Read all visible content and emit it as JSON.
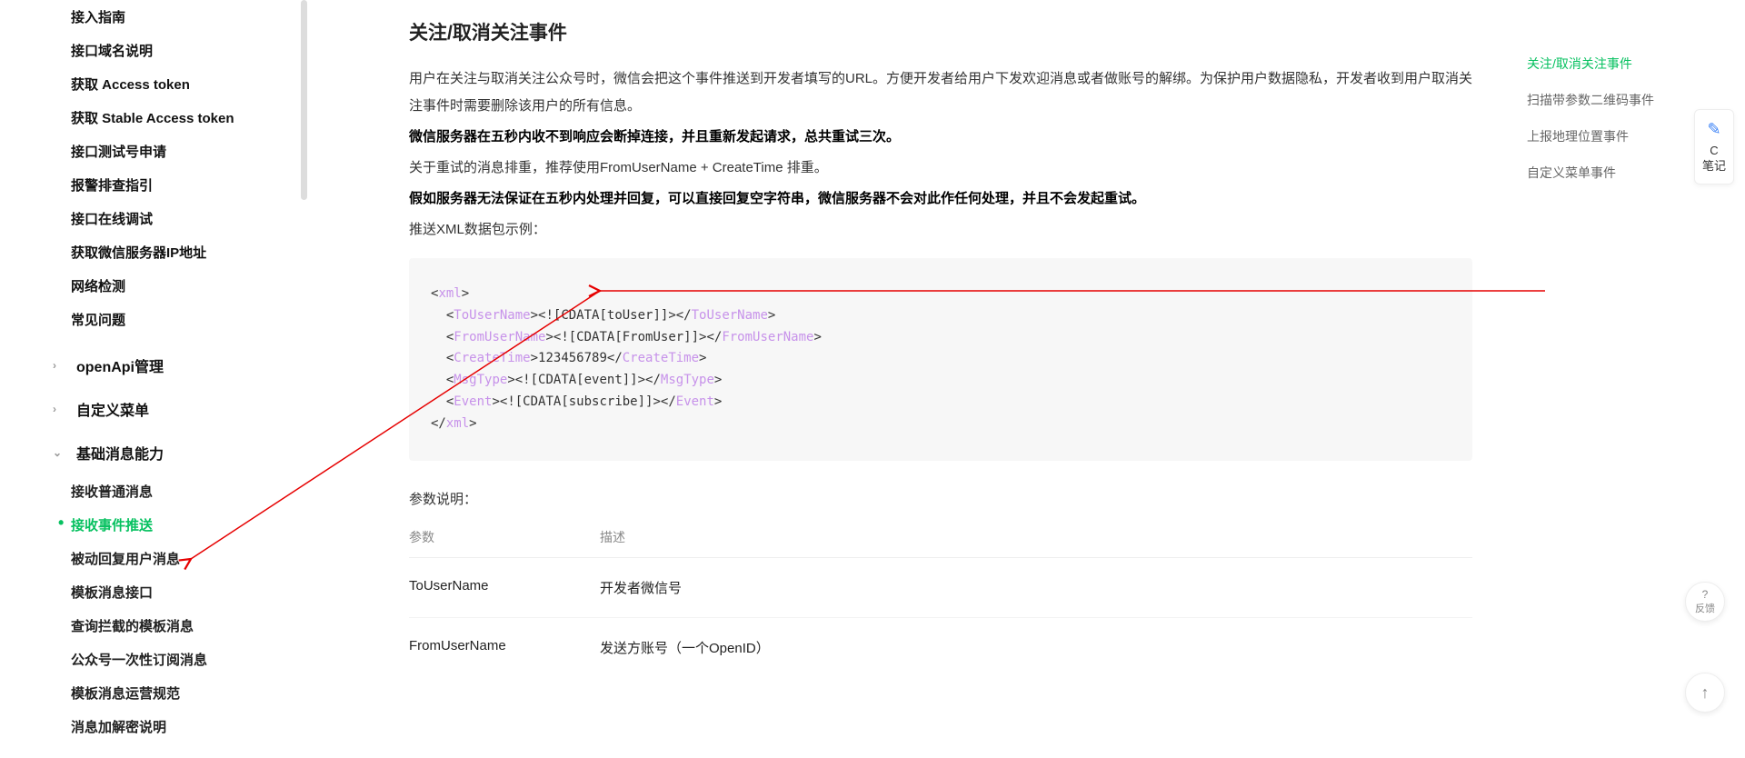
{
  "sidebar": {
    "top_items": [
      "接入指南",
      "接口域名说明",
      "获取 Access token",
      "获取 Stable Access token",
      "接口测试号申请",
      "报警排查指引",
      "接口在线调试",
      "获取微信服务器IP地址",
      "网络检测",
      "常见问题"
    ],
    "groups": [
      {
        "label": "openApi管理",
        "expanded": false,
        "items": []
      },
      {
        "label": "自定义菜单",
        "expanded": false,
        "items": []
      },
      {
        "label": "基础消息能力",
        "expanded": true,
        "items": [
          "接收普通消息",
          "接收事件推送",
          "被动回复用户消息",
          "模板消息接口",
          "查询拦截的模板消息",
          "公众号一次性订阅消息",
          "模板消息运营规范",
          "消息加解密说明"
        ]
      }
    ],
    "active_item": "接收事件推送"
  },
  "content": {
    "heading": "关注/取消关注事件",
    "para1": "用户在关注与取消关注公众号时，微信会把这个事件推送到开发者填写的URL。方便开发者给用户下发欢迎消息或者做账号的解绑。为保护用户数据隐私，开发者收到用户取消关注事件时需要删除该用户的所有信息。",
    "para2": "微信服务器在五秒内收不到响应会断掉连接，并且重新发起请求，总共重试三次。",
    "para3": "关于重试的消息排重，推荐使用FromUserName + CreateTime 排重。",
    "para4": "假如服务器无法保证在五秒内处理并回复，可以直接回复空字符串，微信服务器不会对此作任何处理，并且不会发起重试。",
    "para5": "推送XML数据包示例：",
    "code": {
      "l1a": "xml",
      "l2a": "ToUserName",
      "l2b": "<![CDATA[toUser]]>",
      "l2c": "ToUserName",
      "l3a": "FromUserName",
      "l3b": "<![CDATA[FromUser]]>",
      "l3c": "FromUserName",
      "l4a": "CreateTime",
      "l4b": "123456789",
      "l4c": "CreateTime",
      "l5a": "MsgType",
      "l5b": "<![CDATA[event]]>",
      "l5c": "MsgType",
      "l6a": "Event",
      "l6b": "<![CDATA[subscribe]]>",
      "l6c": "Event",
      "l7a": "xml"
    },
    "param_label": "参数说明：",
    "param_head": {
      "c1": "参数",
      "c2": "描述"
    },
    "param_rows": [
      {
        "c1": "ToUserName",
        "c2": "开发者微信号"
      },
      {
        "c1": "FromUserName",
        "c2": "发送方账号（一个OpenID）"
      }
    ]
  },
  "toc": {
    "items": [
      "关注/取消关注事件",
      "扫描带参数二维码事件",
      "上报地理位置事件",
      "自定义菜单事件"
    ],
    "active": "关注/取消关注事件"
  },
  "float": {
    "notes_char": "C",
    "notes_label": "笔记",
    "feedback": "反馈",
    "help": "?",
    "up": "↑"
  }
}
